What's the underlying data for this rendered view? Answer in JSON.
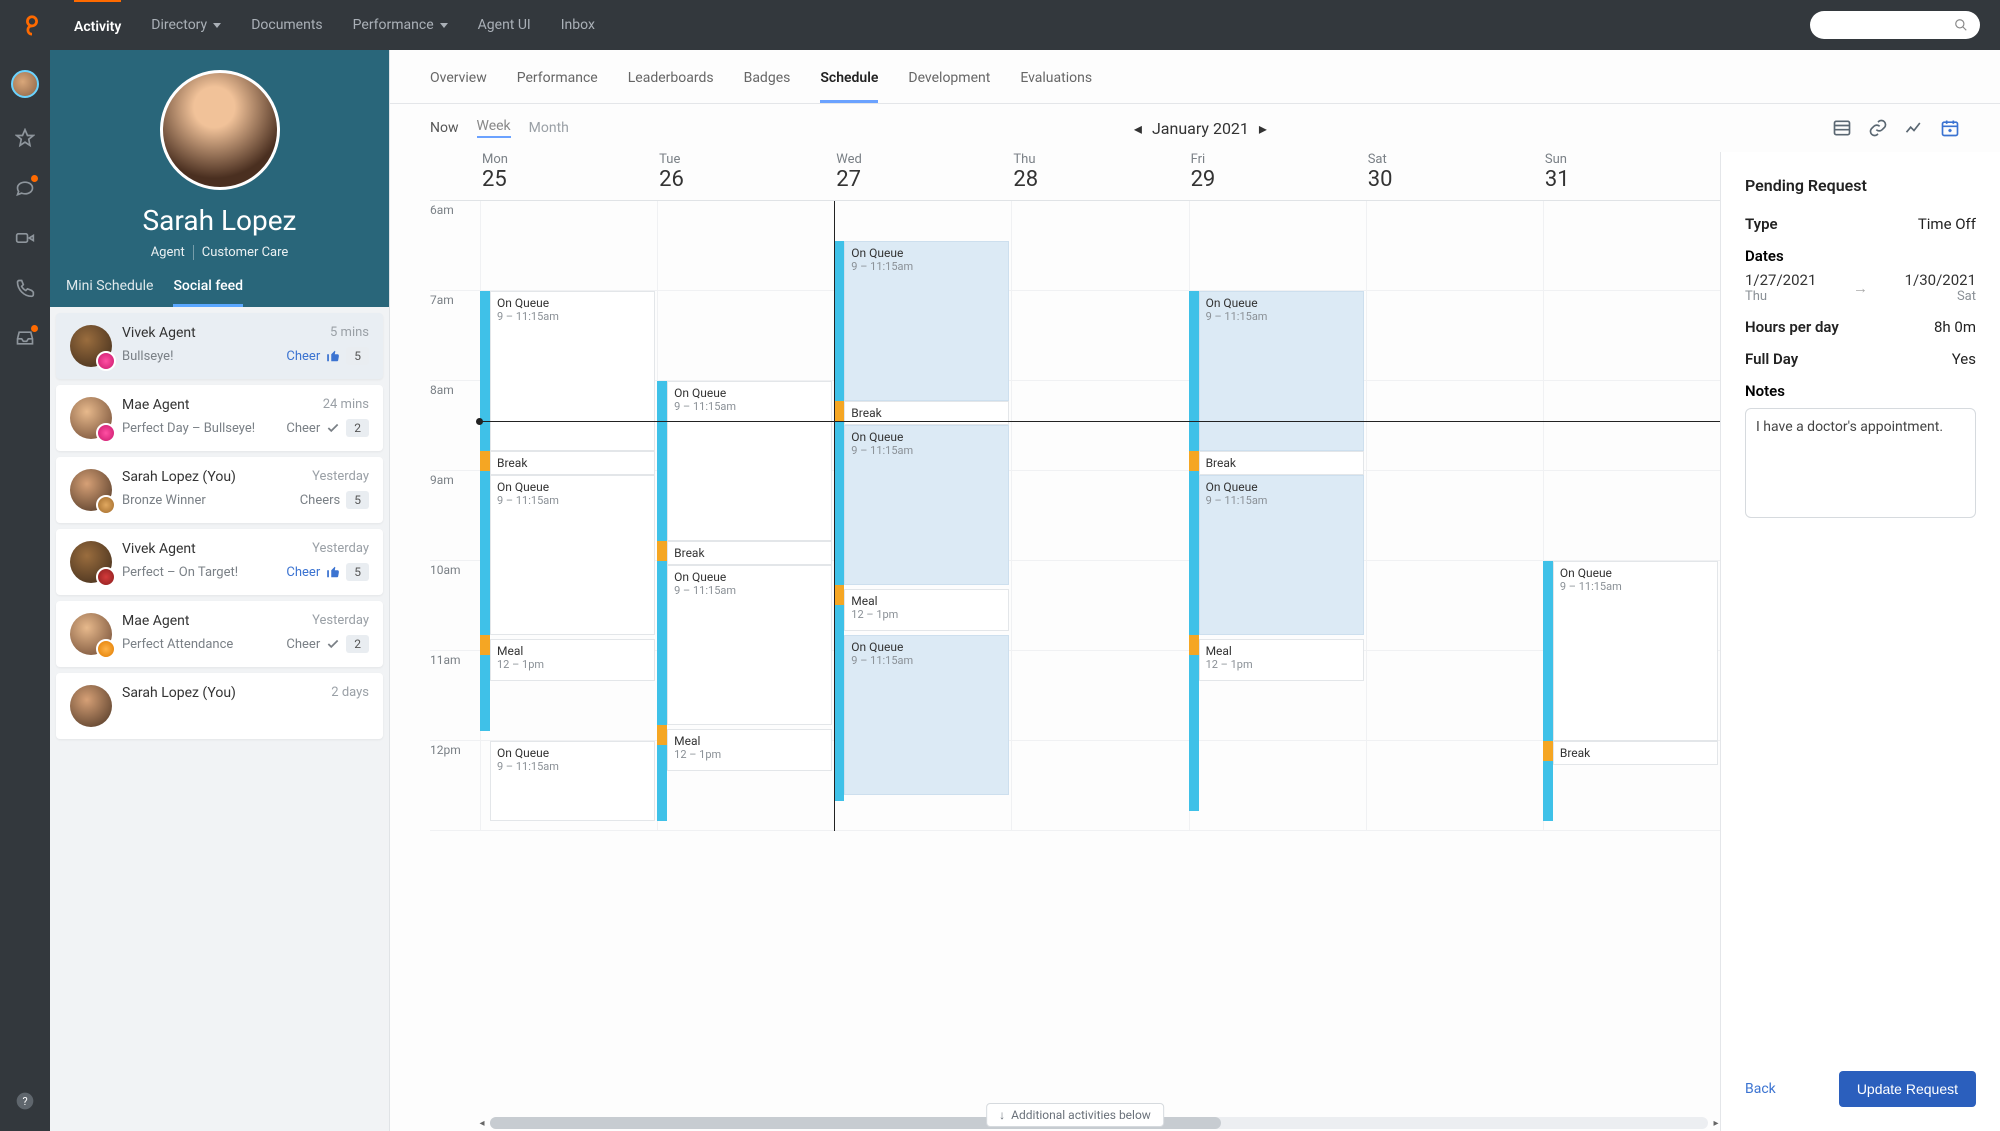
{
  "topnav": {
    "tabs": [
      "Activity",
      "Directory",
      "Documents",
      "Performance",
      "Agent UI",
      "Inbox"
    ],
    "active": "Activity"
  },
  "profile": {
    "name": "Sarah Lopez",
    "role1": "Agent",
    "role2": "Customer Care",
    "subtabs": [
      "Mini Schedule",
      "Social feed"
    ],
    "activeSub": "Social feed"
  },
  "feed": [
    {
      "name": "Vivek Agent",
      "time": "5 mins",
      "msg": "Bullseye!",
      "cheerLabel": "Cheer",
      "cheerStyle": "blue",
      "cheerIcon": "thumb",
      "count": "5",
      "av": "a1",
      "badge": "pink",
      "sel": true
    },
    {
      "name": "Mae Agent",
      "time": "24 mins",
      "msg": "Perfect Day – Bullseye!",
      "cheerLabel": "Cheer",
      "cheerStyle": "gray",
      "cheerIcon": "check",
      "count": "2",
      "av": "a2",
      "badge": "pink"
    },
    {
      "name": "Sarah Lopez (You)",
      "time": "Yesterday",
      "msg": "Bronze Winner",
      "cheerLabel": "Cheers",
      "cheerStyle": "gray",
      "cheerIcon": "",
      "count": "5",
      "av": "a3",
      "badge": "bronze"
    },
    {
      "name": "Vivek Agent",
      "time": "Yesterday",
      "msg": "Perfect – On Target!",
      "cheerLabel": "Cheer",
      "cheerStyle": "blue",
      "cheerIcon": "thumb",
      "count": "5",
      "av": "a1",
      "badge": "red"
    },
    {
      "name": "Mae Agent",
      "time": "Yesterday",
      "msg": "Perfect Attendance",
      "cheerLabel": "Cheer",
      "cheerStyle": "gray",
      "cheerIcon": "check",
      "count": "2",
      "av": "a2",
      "badge": "orange"
    },
    {
      "name": "Sarah Lopez (You)",
      "time": "2 days",
      "msg": "",
      "cheerLabel": "",
      "cheerStyle": "",
      "cheerIcon": "",
      "count": "",
      "av": "a3",
      "badge": ""
    }
  ],
  "pagetabs": [
    "Overview",
    "Performance",
    "Leaderboards",
    "Badges",
    "Schedule",
    "Development",
    "Evaluations"
  ],
  "activePageTab": "Schedule",
  "toolbar": {
    "now": "Now",
    "week": "Week",
    "month": "Month",
    "title": "January 2021"
  },
  "days": [
    {
      "name": "Mon",
      "num": "25"
    },
    {
      "name": "Tue",
      "num": "26"
    },
    {
      "name": "Wed",
      "num": "27"
    },
    {
      "name": "Thu",
      "num": "28"
    },
    {
      "name": "Fri",
      "num": "29"
    },
    {
      "name": "Sat",
      "num": "30"
    },
    {
      "name": "Sun",
      "num": "31"
    }
  ],
  "hours": [
    "6am",
    "7am",
    "8am",
    "9am",
    "10am",
    "11am",
    "12pm"
  ],
  "eventLabels": {
    "onQueue": "On Queue",
    "queueTime": "9 – 11:15am",
    "break": "Break",
    "meal": "Meal",
    "mealTime": "12 – 1pm"
  },
  "addl": "Additional activities below",
  "request": {
    "title": "Pending Request",
    "typeLabel": "Type",
    "typeValue": "Time Off",
    "datesLabel": "Dates",
    "fromDate": "1/27/2021",
    "fromDay": "Thu",
    "toDate": "1/30/2021",
    "toDay": "Sat",
    "hpdLabel": "Hours per day",
    "hpdValue": "8h 0m",
    "fullLabel": "Full Day",
    "fullValue": "Yes",
    "notesLabel": "Notes",
    "notesValue": "I have a doctor's appointment.",
    "back": "Back",
    "update": "Update Request"
  }
}
